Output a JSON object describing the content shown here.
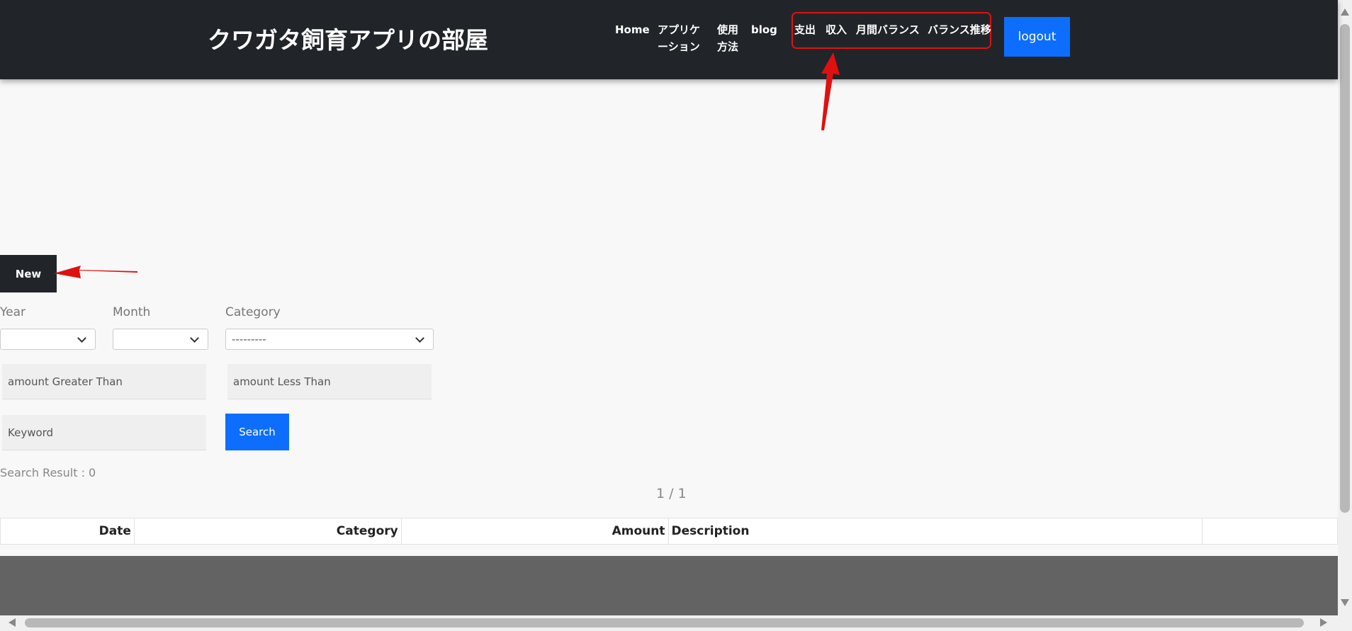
{
  "header": {
    "site_title": "クワガタ飼育アプリの部屋",
    "nav": {
      "home": "Home",
      "application": "アプリケーション",
      "usage": "使用方法",
      "blog": "blog",
      "expense": "支出",
      "income": "収入",
      "monthly_balance": "月間バランス",
      "balance_trend": "バランス推移"
    },
    "logout_label": "logout"
  },
  "actions": {
    "new_label": "New",
    "search_label": "Search"
  },
  "filters": {
    "year_label": "Year",
    "month_label": "Month",
    "category_label": "Category",
    "year_value": "",
    "month_value": "",
    "category_value": "---------",
    "amount_gt_placeholder": "amount Greater Than",
    "amount_lt_placeholder": "amount Less Than",
    "keyword_placeholder": "Keyword"
  },
  "results": {
    "summary": "Search Result : 0",
    "pagination": "1 / 1"
  },
  "table": {
    "headers": [
      "Date",
      "Category",
      "Amount",
      "Description",
      ""
    ]
  },
  "annotations": {
    "arrow_color": "#e01010",
    "highlight_color": "#e01010"
  },
  "colors": {
    "header_bg": "#212529",
    "primary_button": "#0d6efd",
    "page_bg": "#f8f8f8"
  }
}
